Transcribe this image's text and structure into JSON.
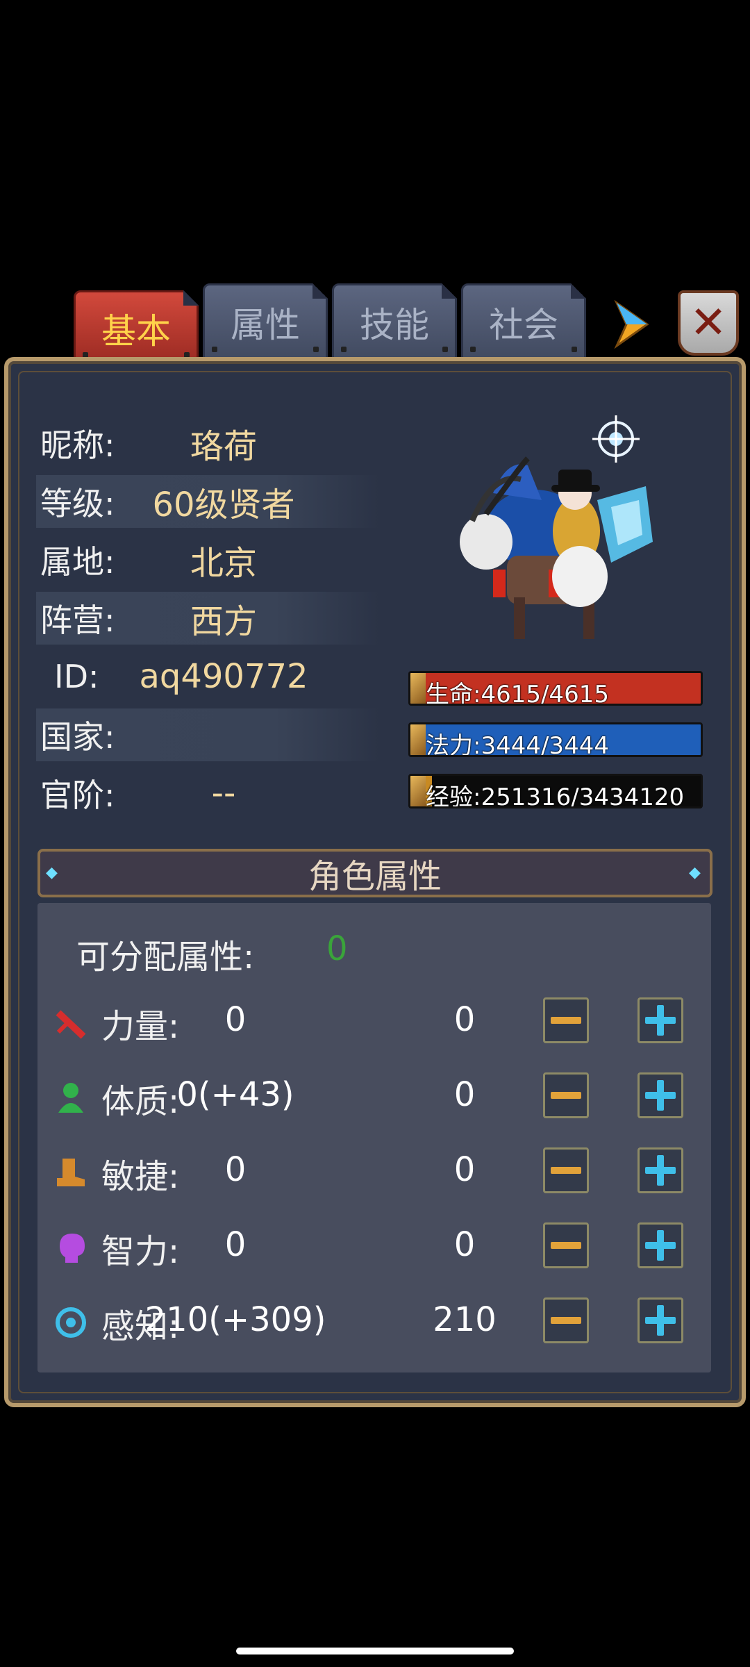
{
  "tabs": [
    "基本",
    "属性",
    "技能",
    "社会"
  ],
  "active_tab": "基本",
  "close_glyph": "✕",
  "profile": {
    "rows": [
      {
        "label": "昵称:",
        "value": "珞荷"
      },
      {
        "label": "等级:",
        "value": "60级贤者"
      },
      {
        "label": "属地:",
        "value": "北京"
      },
      {
        "label": "阵营:",
        "value": "西方"
      },
      {
        "label": "ID:",
        "value": "aq490772"
      },
      {
        "label": "国家:",
        "value": ""
      },
      {
        "label": "官阶:",
        "value": "--"
      }
    ]
  },
  "bars": {
    "hp": {
      "text": "生命:4615/4615",
      "fill": 1.0,
      "color": "#c33121"
    },
    "mp": {
      "text": "法力:3444/3444",
      "fill": 1.0,
      "color": "#1f5fb9"
    },
    "exp": {
      "text": "经验:251316/3434120",
      "fill": 0.073,
      "color": "#c88a22"
    }
  },
  "attributes": {
    "section_title": "角色属性",
    "allocatable_label": "可分配属性:",
    "allocatable_value": "0",
    "rows": [
      {
        "label": "力量:",
        "base": "0",
        "alloc": "0",
        "icon": "sword-icon"
      },
      {
        "label": "体质:",
        "base": "0(+43)",
        "alloc": "0",
        "icon": "person-icon"
      },
      {
        "label": "敏捷:",
        "base": "0",
        "alloc": "0",
        "icon": "boot-icon"
      },
      {
        "label": "智力:",
        "base": "0",
        "alloc": "0",
        "icon": "head-icon"
      },
      {
        "label": "感知:",
        "base": "210(+309)",
        "alloc": "210",
        "icon": "target-icon"
      }
    ]
  },
  "colors": {
    "accent_minus": "#e2a23a",
    "accent_plus": "#3fbfe9",
    "allocatable": "#3aa43a"
  }
}
